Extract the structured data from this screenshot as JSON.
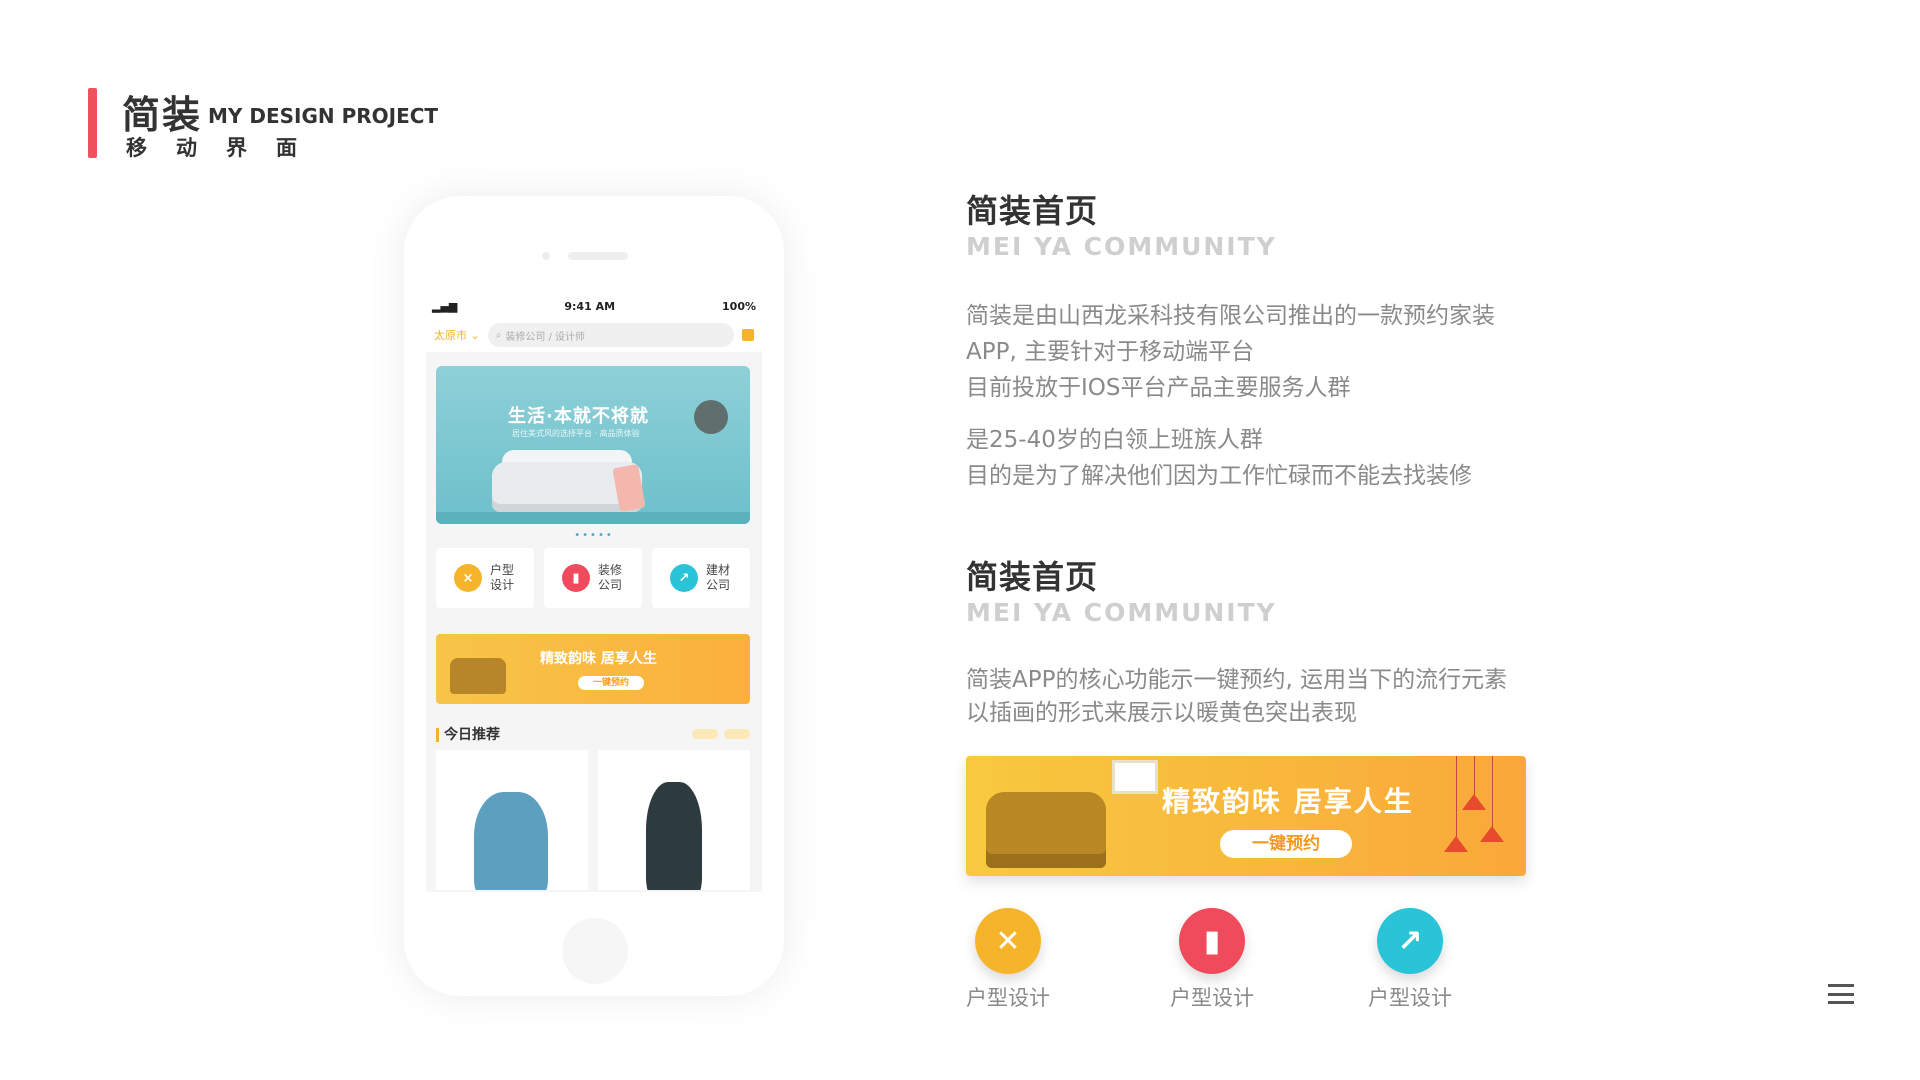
{
  "header": {
    "title": "简装",
    "title_en": "MY DESIGN PROJECT",
    "subtitle_chars": [
      "移",
      "动",
      "界",
      "面"
    ]
  },
  "phone": {
    "status": {
      "time": "9:41 AM",
      "battery": "100%"
    },
    "city": "太原市",
    "search_placeholder": "装修公司 / 设计师",
    "hero": {
      "title": "生活·本就不将就",
      "subtitle": "居住美式风的选择平台 · 高品质体验"
    },
    "carousel_dots": "•••••",
    "categories": [
      {
        "label": "户型设计",
        "color": "#f6b42b",
        "icon": "×"
      },
      {
        "label": "装修公司",
        "color": "#ef4b5d",
        "icon": "▮"
      },
      {
        "label": "建材公司",
        "color": "#2bc3d7",
        "icon": "↗"
      }
    ],
    "banner": {
      "title": "精致韵味 居享人生",
      "button": "一键预约"
    },
    "recommend_title": "今日推荐"
  },
  "sections": [
    {
      "title": "简装首页",
      "subtitle": "MEI YA COMMUNITY",
      "paragraphs": [
        "简装是由山西龙采科技有限公司推出的一款预约家装",
        "APP, 主要针对于移动端平台",
        "目前投放于IOS平台产品主要服务人群",
        "是25-40岁的白领上班族人群",
        "目的是为了解决他们因为工作忙碌而不能去找装修"
      ]
    },
    {
      "title": "简装首页",
      "subtitle": "MEI YA COMMUNITY",
      "paragraphs": [
        "简装APP的核心功能示一键预约, 运用当下的流行元素",
        "以插画的形式来展示以暖黄色突出表现"
      ]
    }
  ],
  "big_banner": {
    "title": "精致韵味 居享人生",
    "button": "一键预约"
  },
  "features": [
    {
      "label": "户型设计",
      "color": "#f6b42b",
      "icon": "✕"
    },
    {
      "label": "户型设计",
      "color": "#ef4b5d",
      "icon": "▮"
    },
    {
      "label": "户型设计",
      "color": "#2bc3d7",
      "icon": "↗"
    }
  ],
  "colors": {
    "accent": "#f0525d",
    "yellow": "#f6b42b",
    "red": "#ef4b5d",
    "cyan": "#2bc3d7"
  }
}
